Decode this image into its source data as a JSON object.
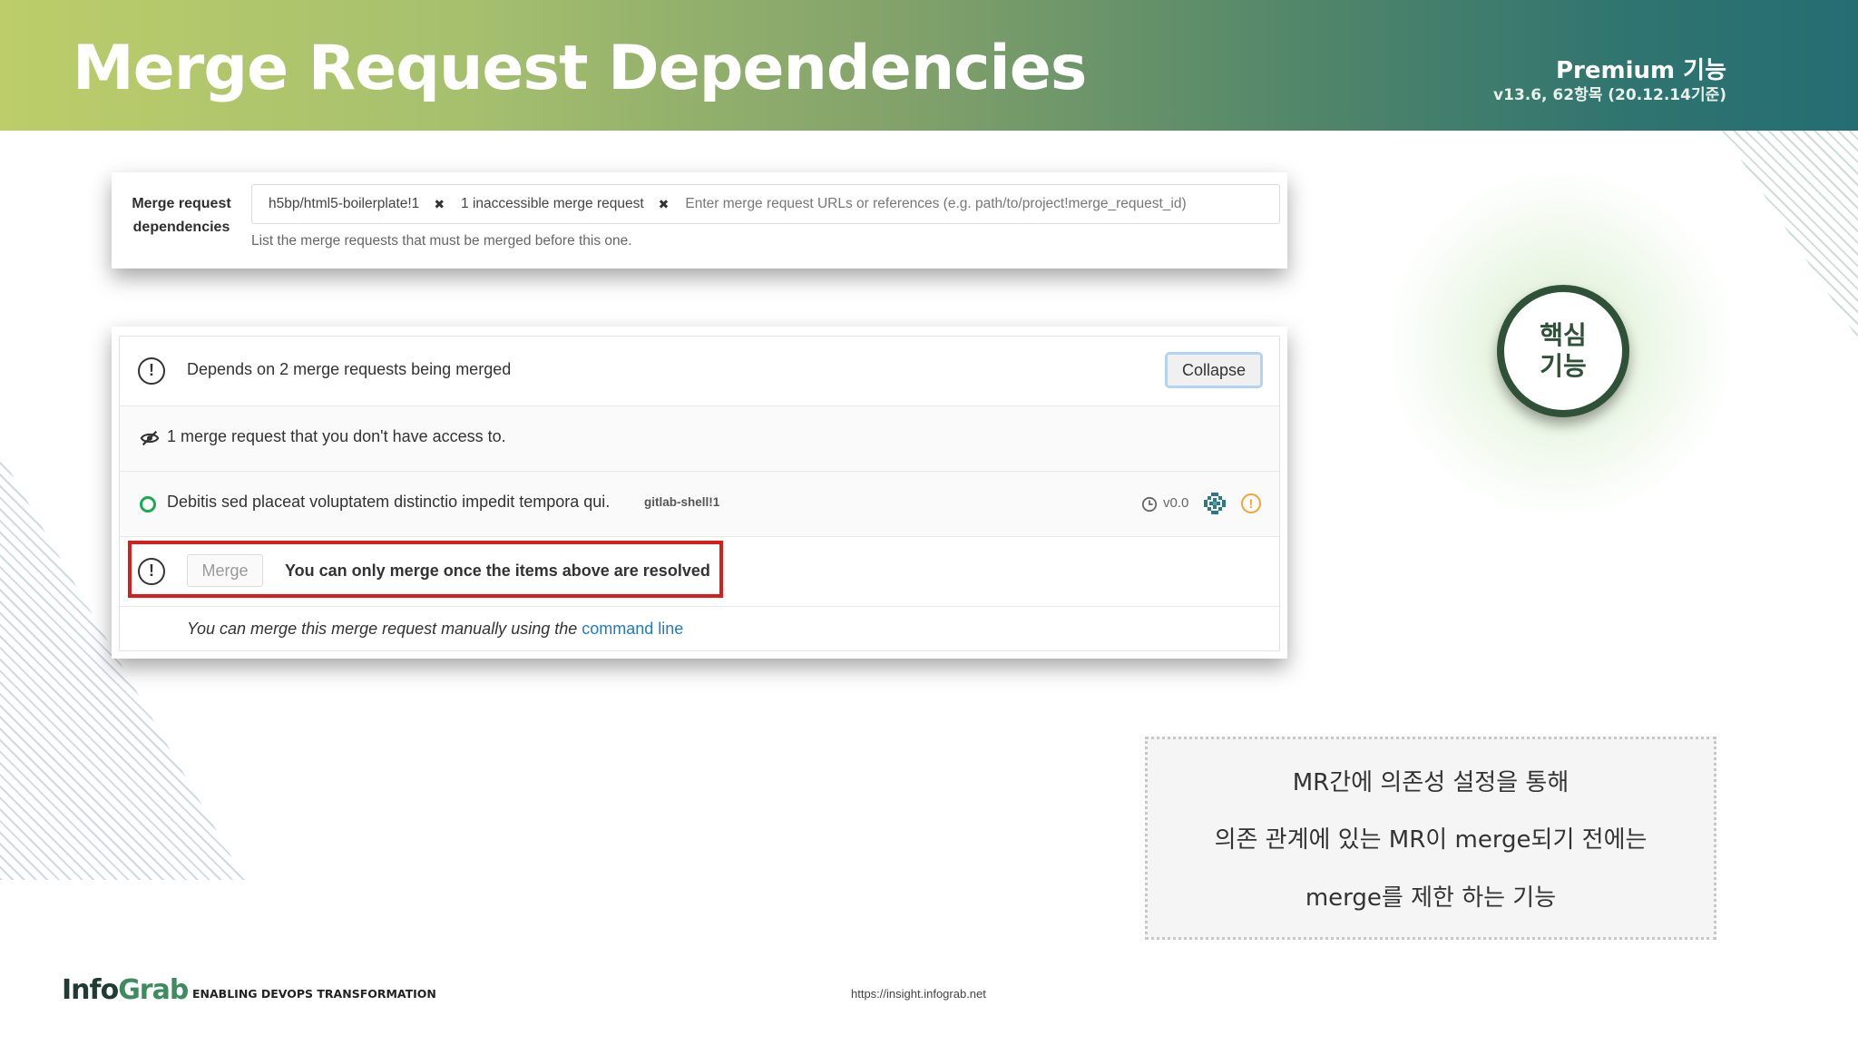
{
  "header": {
    "title": "Merge Request Dependencies",
    "premium_label": "Premium 기능",
    "version_label": "v13.6, 62항목 (20.12.14기준)"
  },
  "settings_panel": {
    "label_line1": "Merge request",
    "label_line2": "dependencies",
    "tokens": [
      {
        "label": "h5bp/html5-boilerplate!1",
        "remove_glyph": "✖"
      },
      {
        "label": "1 inaccessible merge request",
        "remove_glyph": "✖"
      }
    ],
    "input_placeholder": "Enter merge request URLs or references (e.g. path/to/project!merge_request_id)",
    "help_text": "List the merge requests that must be merged before this one."
  },
  "widget": {
    "header_text": "Depends on 2 merge requests being merged",
    "collapse_label": "Collapse",
    "inaccessible_text": "1 merge request that you don't have access to.",
    "dependency": {
      "title": "Debitis sed placeat voluptatem distinctio impedit tempora qui.",
      "reference": "gitlab-shell!1",
      "milestone": "v0.0",
      "status_color": "#1aaa55"
    },
    "merge_label": "Merge",
    "blocked_text": "You can only merge once the items above are resolved",
    "manual_text": "You can merge this merge request manually using the",
    "manual_link": "command line"
  },
  "badge": {
    "line1": "핵심",
    "line2": "기능"
  },
  "description": {
    "lines": [
      "MR간에 의존성 설정을 통해",
      "의존 관계에 있는 MR이 merge되기 전에는",
      "merge를 제한 하는 기능"
    ]
  },
  "footer": {
    "logo_part1": "Info",
    "logo_part2": "Grab",
    "tagline": "ENABLING DEVOPS TRANSFORMATION",
    "url": "https://insight.infograb.net"
  },
  "colors": {
    "accent_red": "#d91c1c",
    "link_blue": "#1f78d1",
    "badge_green": "#2e5138",
    "warning_orange": "#f1a534"
  }
}
